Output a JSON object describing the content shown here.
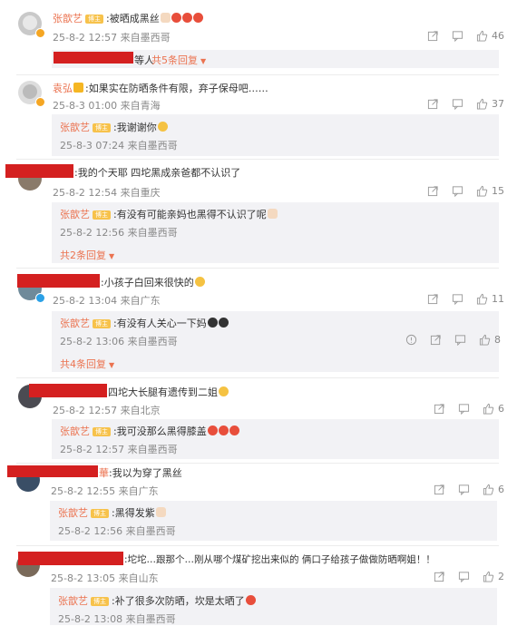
{
  "icons": {
    "share": "share-icon",
    "comment": "comment-icon",
    "like": "like-icon",
    "report": "report-icon"
  },
  "colors": {
    "username": "#eb7350",
    "redaction": "#d42020",
    "reply_bg": "#f2f2f5",
    "badge": "#f7c24b"
  },
  "tag_text": "博主",
  "comments": [
    {
      "user": "张歆艺",
      "text": ":被晒成黑丝",
      "meta": "25-8-2 12:57 来自墨西哥",
      "likes": "46",
      "replies_tail": "等人",
      "more": "共5条回复"
    },
    {
      "user": "袁弘",
      "text": ":如果实在防晒条件有限，弃子保母吧……",
      "meta": "25-8-3 01:00 来自青海",
      "likes": "37",
      "reply": {
        "user": "张歆艺",
        "text": ":我谢谢你",
        "meta": "25-8-3 07:24 来自墨西哥"
      }
    },
    {
      "text": ":我的个天耶 四坨黑成亲爸都不认识了",
      "meta": "25-8-2 12:54 来自重庆",
      "likes": "15",
      "reply": {
        "user": "张歆艺",
        "text": ":有没有可能亲妈也黑得不认识了呢",
        "meta": "25-8-2 12:56 来自墨西哥"
      },
      "more": "共2条回复"
    },
    {
      "text": ":小孩子白回来很快的",
      "meta": "25-8-2 13:04 来自广东",
      "likes": "11",
      "reply": {
        "user": "张歆艺",
        "text": ":有没有人关心一下妈",
        "meta": "25-8-2 13:06 来自墨西哥",
        "likes": "8"
      },
      "more": "共4条回复"
    },
    {
      "text": "四坨大长腿有遗传到二姐",
      "meta": "25-8-2 12:57 来自北京",
      "likes": "6",
      "reply": {
        "user": "张歆艺",
        "text": ":我可没那么黑得膝盖",
        "meta": "25-8-2 12:57 来自墨西哥"
      }
    },
    {
      "user_tail": "華",
      "text": ":我以为穿了黑丝",
      "meta": "25-8-2 12:55 来自广东",
      "likes": "6",
      "reply": {
        "user": "张歆艺",
        "text": ":黑得发紫",
        "meta": "25-8-2 12:56 来自墨西哥"
      }
    },
    {
      "text": ":坨坨…跟那个…刚从哪个煤矿挖出来似的 俩口子给孩子做做防晒啊姐！！",
      "text_pre": "坨坨…跟那个…刚从哪个煤矿挖出来似的 ",
      "meta": "25-8-2 13:05 来自山东",
      "likes": "2",
      "reply": {
        "user": "张歆艺",
        "text": ":补了很多次防晒，坎是太晒了",
        "meta": "25-8-2 13:08 来自墨西哥"
      }
    }
  ]
}
